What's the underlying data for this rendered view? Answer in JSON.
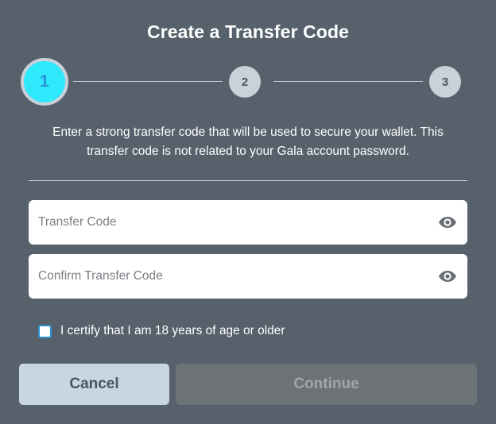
{
  "dialog": {
    "title": "Create a Transfer Code",
    "description_line1": "Enter a strong transfer code that will be used to secure your wallet. This",
    "description_line2": "transfer code is not related to your Gala account password."
  },
  "stepper": {
    "steps": [
      {
        "label": "1",
        "state": "active"
      },
      {
        "label": "2",
        "state": "inactive"
      },
      {
        "label": "3",
        "state": "inactive"
      }
    ],
    "active_color": "#2ee8fb",
    "inactive_color": "#c9d1d9"
  },
  "form": {
    "transfer_code": {
      "value": "",
      "placeholder": "Transfer Code",
      "icon": "eye-icon"
    },
    "confirm_transfer_code": {
      "value": "",
      "placeholder": "Confirm Transfer Code",
      "icon": "eye-icon"
    },
    "age_checkbox": {
      "label": "I certify that I am 18 years of age or older",
      "checked": false
    }
  },
  "actions": {
    "cancel_label": "Cancel",
    "continue_label": "Continue",
    "continue_disabled": true
  },
  "colors": {
    "background": "#56616b",
    "cancel_bg": "#c9d6e0",
    "continue_bg_disabled": "#6d7277"
  }
}
